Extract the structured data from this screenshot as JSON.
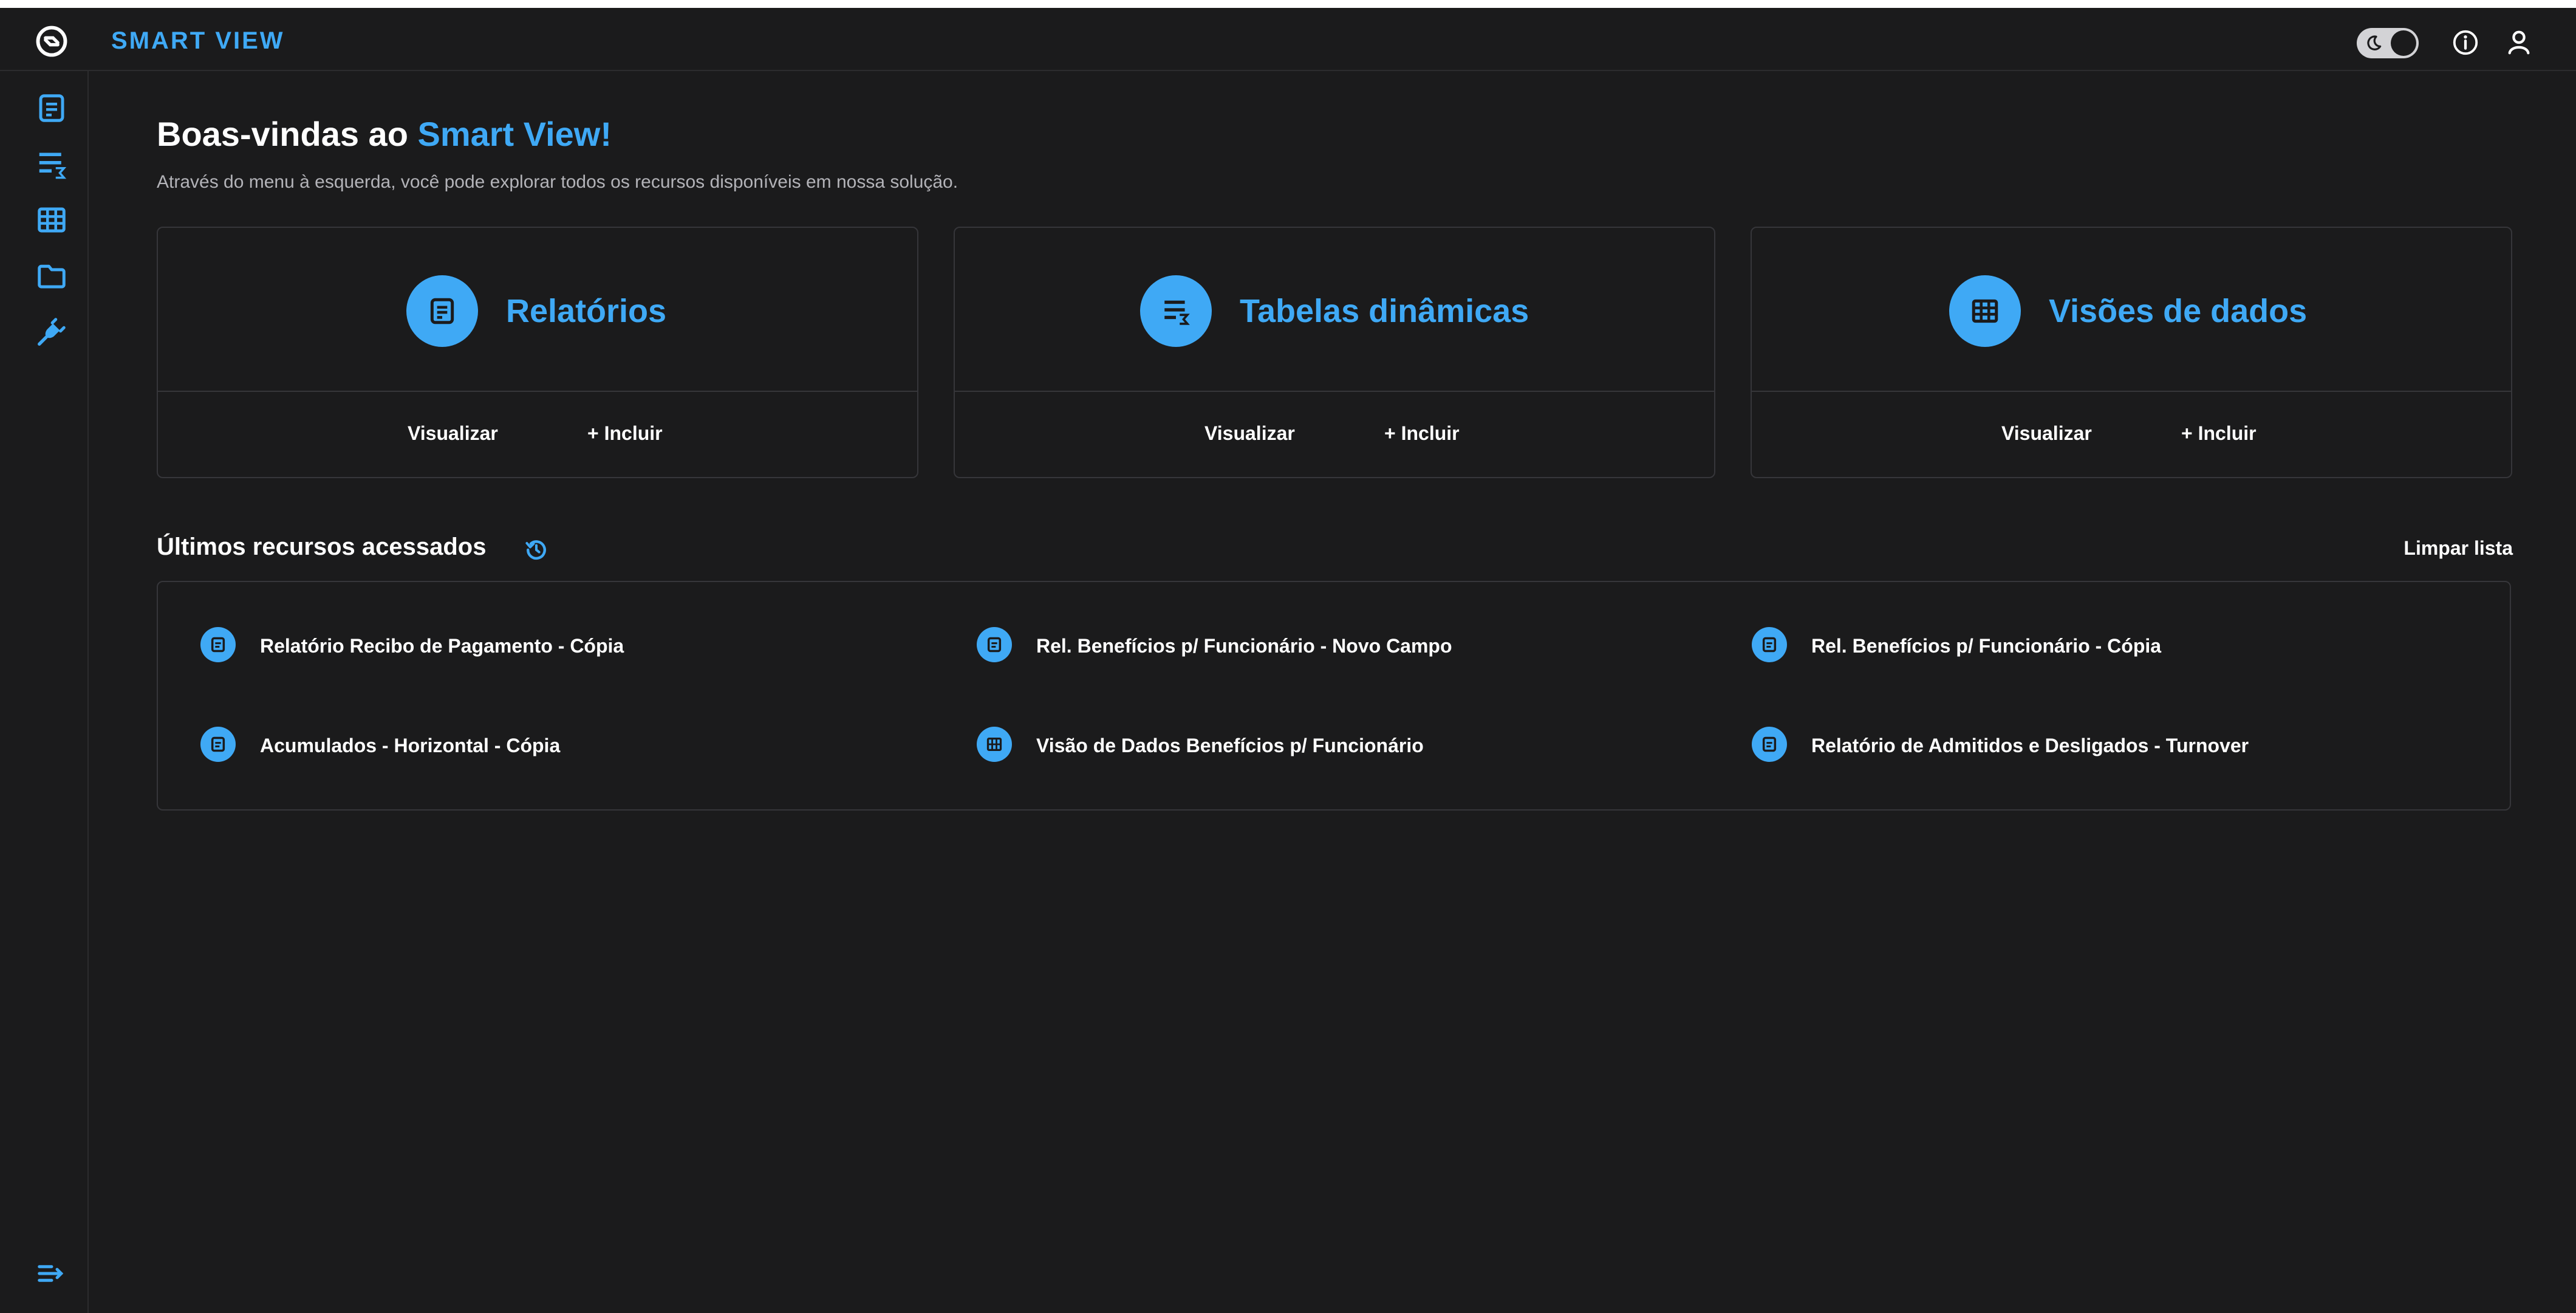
{
  "header": {
    "brand": "SMART VIEW",
    "icons": [
      "smart-view-logo-icon",
      "theme-toggle",
      "info-icon",
      "user-icon"
    ]
  },
  "sidebar": {
    "items": [
      {
        "icon": "report-icon"
      },
      {
        "icon": "pivot-table-icon"
      },
      {
        "icon": "data-grid-icon"
      },
      {
        "icon": "folder-icon"
      },
      {
        "icon": "plug-icon"
      }
    ],
    "collapse_icon": "expand-menu-icon"
  },
  "welcome": {
    "title_prefix": "Boas-vindas ao ",
    "title_highlight": "Smart View!",
    "subtitle": "Através do menu à esquerda, você pode explorar todos os recursos disponíveis em nossa solução."
  },
  "cards": [
    {
      "title": "Relatórios",
      "icon": "report-icon",
      "view_label": "Visualizar",
      "add_label": "+ Incluir"
    },
    {
      "title": "Tabelas dinâmicas",
      "icon": "pivot-table-icon",
      "view_label": "Visualizar",
      "add_label": "+ Incluir"
    },
    {
      "title": "Visões de dados",
      "icon": "data-grid-icon",
      "view_label": "Visualizar",
      "add_label": "+ Incluir"
    }
  ],
  "recent": {
    "title": "Últimos recursos acessados",
    "clear_label": "Limpar lista",
    "items": [
      {
        "label": "Relatório Recibo de Pagamento - Cópia",
        "icon": "report-icon"
      },
      {
        "label": "Rel. Benefícios p/ Funcionário - Novo Campo",
        "icon": "report-icon"
      },
      {
        "label": "Rel. Benefícios p/ Funcionário - Cópia",
        "icon": "report-icon"
      },
      {
        "label": "Acumulados - Horizontal - Cópia",
        "icon": "report-icon"
      },
      {
        "label": "Visão de Dados Benefícios p/ Funcionário",
        "icon": "data-grid-icon"
      },
      {
        "label": "Relatório de Admitidos e Desligados - Turnover",
        "icon": "report-icon"
      }
    ]
  },
  "colors": {
    "background": "#1b1b1c",
    "accent": "#3fa9f5",
    "border": "#36363a",
    "text": "#ffffff",
    "muted_text": "#b3b3b8"
  }
}
